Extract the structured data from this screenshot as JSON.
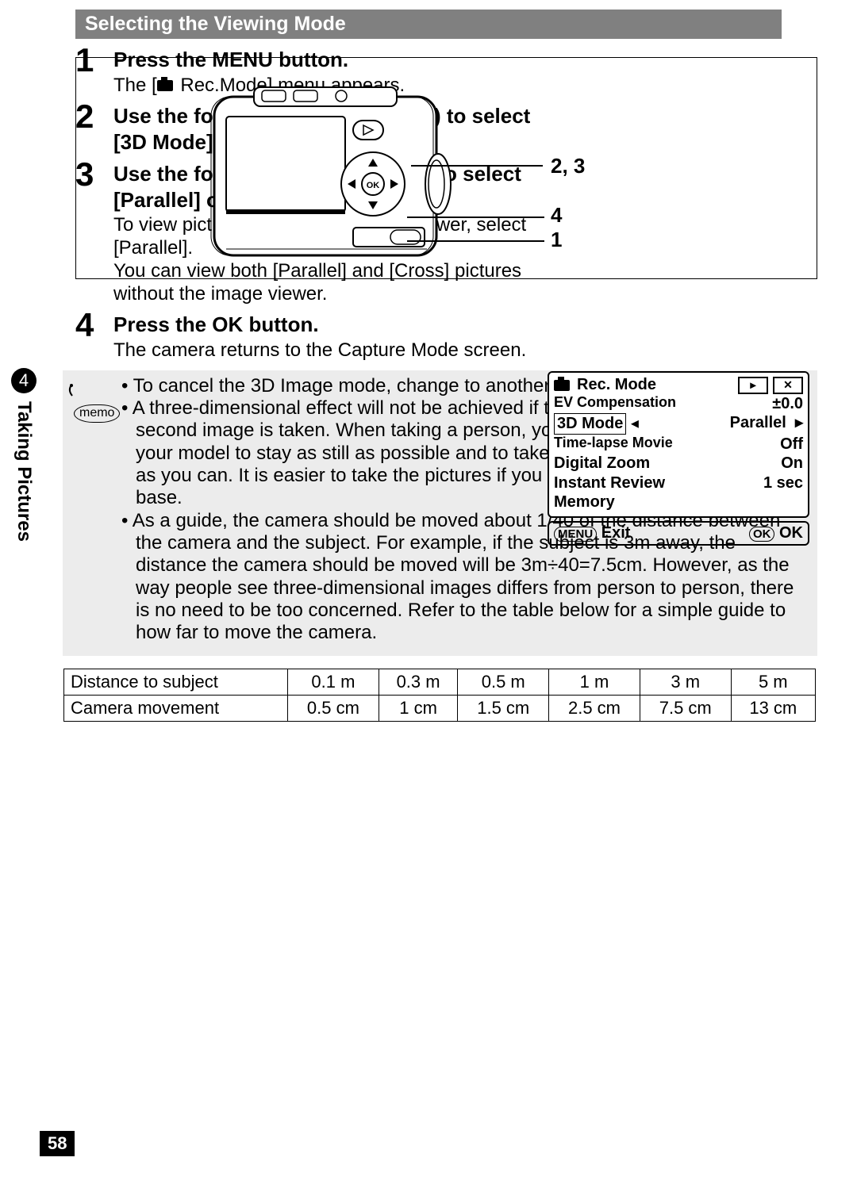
{
  "callouts": {
    "c1": "2, 3",
    "c2": "4",
    "c3": "1"
  },
  "section_header": "Selecting the Viewing Mode",
  "side_tab": {
    "num": "4",
    "label": "Taking Pictures"
  },
  "steps": {
    "s1": {
      "num": "1",
      "title": "Press the MENU button.",
      "text_prefix": "The [",
      "text_suffix": " Rec.Mode] menu appears."
    },
    "s2": {
      "num": "2",
      "title": "Use the four-way controller (▲▼) to select [3D Mode]."
    },
    "s3": {
      "num": "3",
      "title": "Use the four-way controller (◀▶) to select [Parallel] or [Cross].",
      "text": "To view pictures with the 3D image viewer, select [Parallel].\nYou can view both [Parallel] and [Cross] pictures without the image viewer."
    },
    "s4": {
      "num": "4",
      "title": "Press the OK button.",
      "text": "The camera returns to the Capture Mode screen."
    }
  },
  "rec_panel": {
    "title": "Rec. Mode",
    "play_icon": "▸",
    "tool_icon": "✕",
    "rows": {
      "ev": {
        "label": "EV Compensation",
        "value": "±0.0"
      },
      "mode3d": {
        "label": "3D Mode",
        "value": "Parallel"
      },
      "tlm": {
        "label": "Time-lapse Movie",
        "value": "Off"
      },
      "dz": {
        "label": "Digital Zoom",
        "value": "On"
      },
      "ir": {
        "label": "Instant Review",
        "value": "1 sec"
      },
      "mem": {
        "label": "Memory"
      }
    },
    "footer": {
      "menu_btn": "MENU",
      "exit": "Exit",
      "ok_btn": "OK",
      "ok": "OK"
    }
  },
  "memo": {
    "badge": "memo",
    "items": [
      "To cancel the 3D Image mode, change to another Capture mode.",
      "A three-dimensional effect will not be achieved if the subject moves before the second image is taken. When taking a person, you are recommended to ask your model to stay as still as possible and to take the second picture as quickly as you can. It is easier to take the pictures if you use a tripod or appropriate base.",
      "As a guide, the camera should be moved about 1/40 of the distance between the camera and the subject. For example, if the subject is 3m away, the distance the camera should be moved will be 3m÷40=7.5cm. However, as the way people see three-dimensional images differs from person to person, there is no need to be too concerned. Refer to the table below for a simple guide to how far to move the camera."
    ]
  },
  "table": {
    "row1_label": "Distance to subject",
    "row1": [
      "0.1 m",
      "0.3 m",
      "0.5 m",
      "1 m",
      "3 m",
      "5 m"
    ],
    "row2_label": "Camera movement",
    "row2": [
      "0.5 cm",
      "1 cm",
      "1.5 cm",
      "2.5 cm",
      "7.5 cm",
      "13 cm"
    ]
  },
  "page_number": "58"
}
